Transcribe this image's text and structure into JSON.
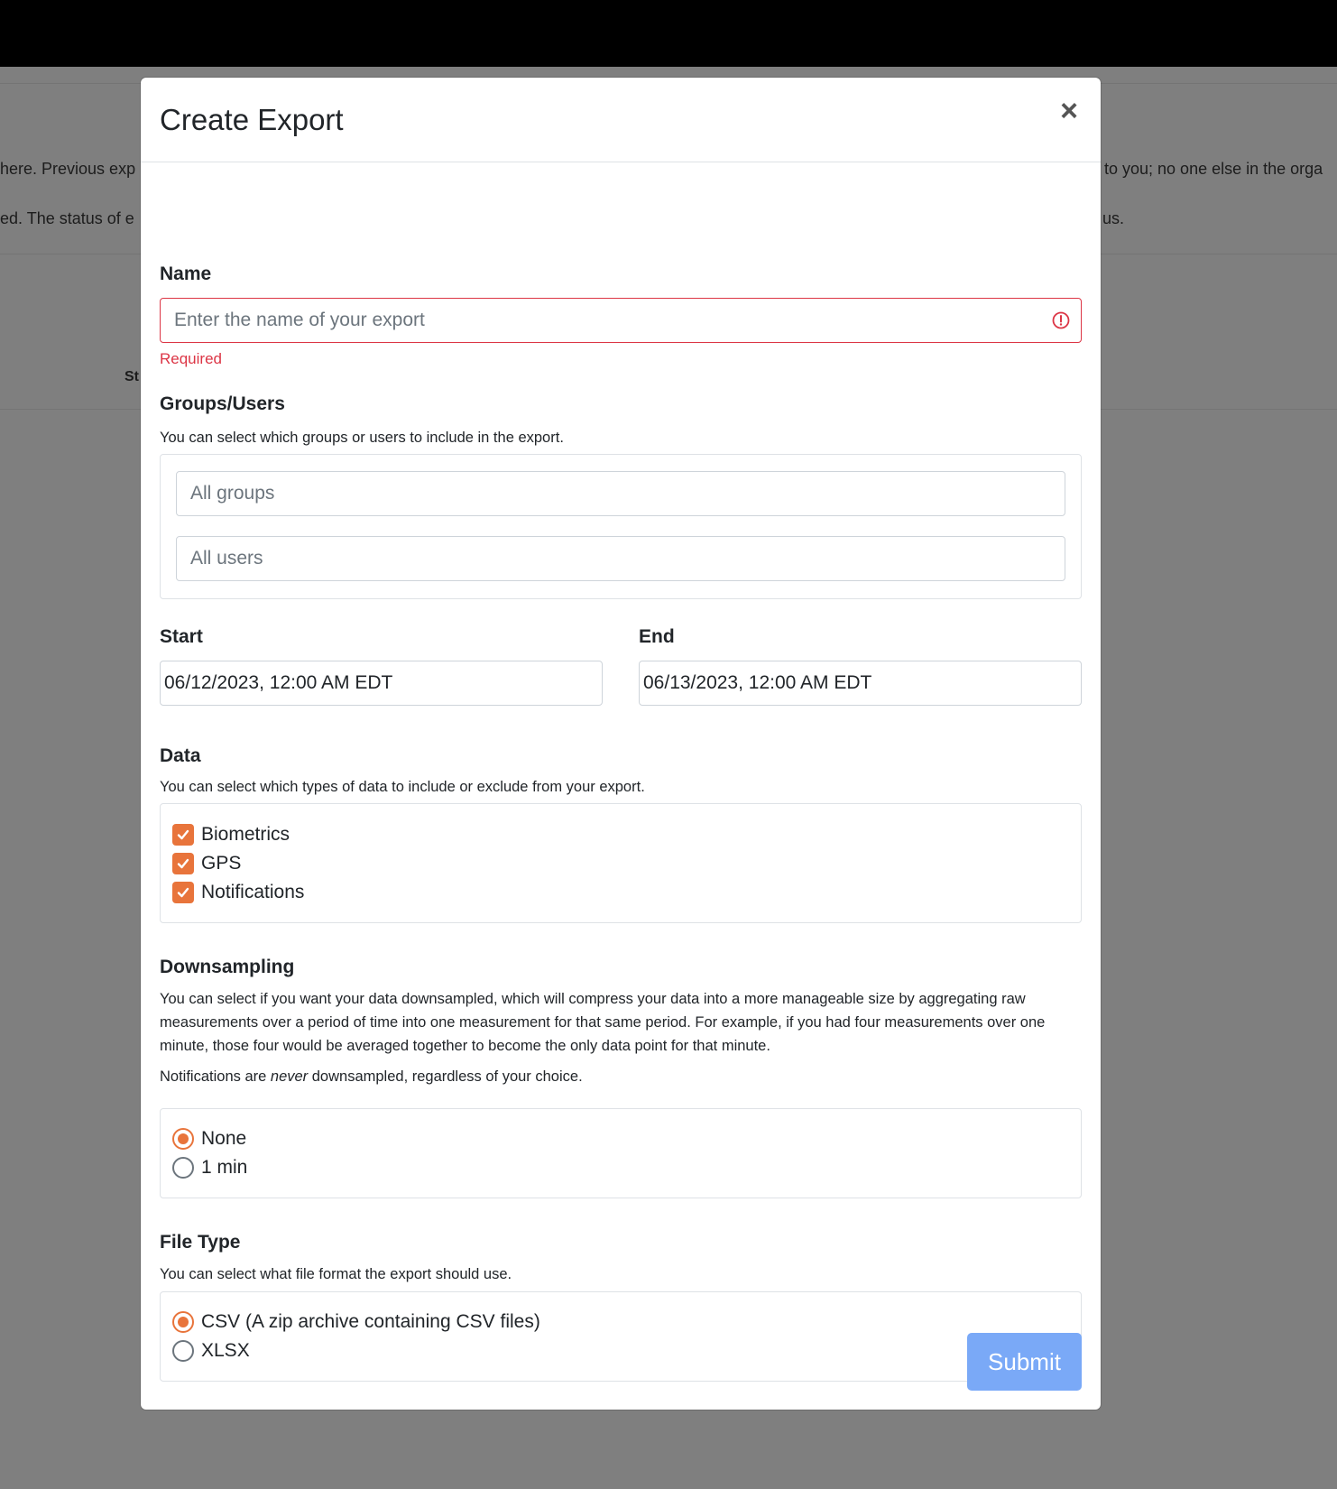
{
  "background": {
    "line1_left": "here. Previous exp",
    "line1_right": "to you; no one else in the orga",
    "line2_left": "ed. The status of e",
    "line2_right": "us.",
    "column_fragment": "St"
  },
  "modal": {
    "title": "Create Export",
    "close_label": "×",
    "name": {
      "label": "Name",
      "placeholder": "Enter the name of your export",
      "error": "Required"
    },
    "groups_users": {
      "label": "Groups/Users",
      "help": "You can select which groups or users to include in the export.",
      "groups_placeholder": "All groups",
      "users_placeholder": "All users"
    },
    "start": {
      "label": "Start",
      "value": "06/12/2023, 12:00 AM EDT"
    },
    "end": {
      "label": "End",
      "value": "06/13/2023, 12:00 AM EDT"
    },
    "data": {
      "label": "Data",
      "help": "You can select which types of data to include or exclude from your export.",
      "options": [
        {
          "label": "Biometrics",
          "checked": true
        },
        {
          "label": "GPS",
          "checked": true
        },
        {
          "label": "Notifications",
          "checked": true
        }
      ]
    },
    "downsampling": {
      "label": "Downsampling",
      "help": "You can select if you want your data downsampled, which will compress your data into a more manageable size by aggregating raw measurements over a period of time into one measurement for that same period. For example, if you had four measurements over one minute, those four would be averaged together to become the only data point for that minute.",
      "note_before": "Notifications are ",
      "note_em": "never",
      "note_after": " downsampled, regardless of your choice.",
      "options": [
        {
          "label": "None",
          "selected": true
        },
        {
          "label": "1 min",
          "selected": false
        }
      ]
    },
    "file_type": {
      "label": "File Type",
      "help": "You can select what file format the export should use.",
      "options": [
        {
          "label": "CSV (A zip archive containing CSV files)",
          "selected": true
        },
        {
          "label": "XLSX",
          "selected": false
        }
      ]
    },
    "submit_label": "Submit"
  },
  "colors": {
    "accent": "#e8743b",
    "submit_disabled": "#7aa9f7",
    "error": "#dc3545"
  }
}
